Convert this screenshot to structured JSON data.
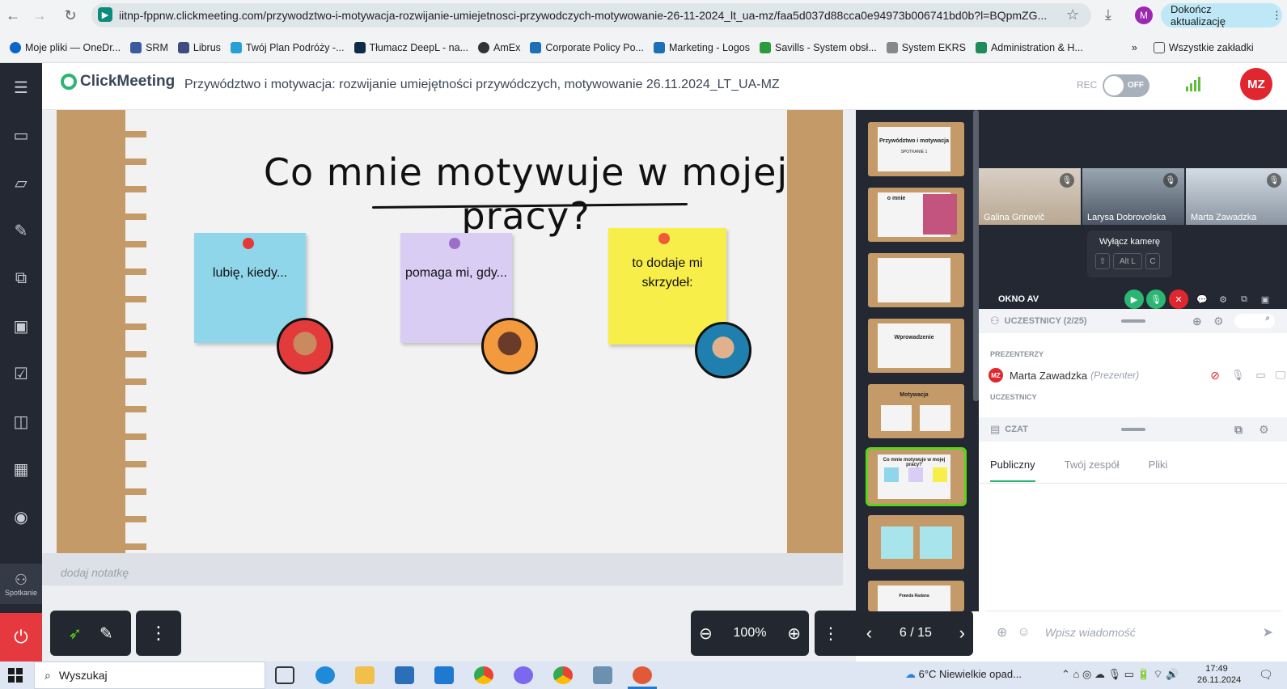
{
  "browser": {
    "url": "iitnp-fppnw.clickmeeting.com/przywodztwo-i-motywacja-rozwijanie-umiejetnosci-przywodczych-motywowanie-26-11-2024_lt_ua-mz/faa5d037d88cca0e94973b006741bd0b?l=BQpmZG...",
    "profile_initial": "M",
    "update_label": "Dokończ aktualizację",
    "bookmarks": [
      "Moje pliki — OneDr...",
      "SRM",
      "Librus",
      "Twój Plan Podróży -...",
      "Tłumacz DeepL - na...",
      "AmEx",
      "Corporate Policy Po...",
      "Marketing - Logos",
      "Savills - System obsł...",
      "System EKRS",
      "Administration & H..."
    ],
    "bookmarks_all": "Wszystkie zakładki"
  },
  "app": {
    "logo": "ClickMeeting",
    "meeting_title": "Przywództwo i motywacja: rozwijanie umiejętności przywódczych, motywowanie 26.11.2024_LT_UA-MZ",
    "rec_label": "REC",
    "rec_state": "OFF",
    "user_initials": "MZ",
    "accent_color": "#2bb673"
  },
  "leftnav": {
    "meeting_label": "Spotkanie"
  },
  "slide": {
    "title": "Co mnie motywuje w mojej pracy?",
    "notes": [
      {
        "text": "lubię, kiedy...",
        "color": "#8fd6ea"
      },
      {
        "text": "pomaga mi, gdy...",
        "color": "#d9cdf3"
      },
      {
        "text": "to dodaje mi skrzydeł:",
        "color": "#f7ee4a"
      }
    ]
  },
  "notes_placeholder": "dodaj notatkę",
  "toolbar": {
    "zoom": "100%",
    "page": "6 / 15"
  },
  "thumbnails": [
    {
      "label": "Przywództwo i motywacja",
      "sub": "SPOTKANIE 1"
    },
    {
      "label": "o mnie",
      "sub": ""
    },
    {
      "label": "",
      "sub": ""
    },
    {
      "label": "Wprowadzenie",
      "sub": ""
    },
    {
      "label": "Motywacja",
      "sub": ""
    },
    {
      "label": "Co mnie motywuje w mojej pracy?",
      "sub": ""
    },
    {
      "label": "",
      "sub": ""
    },
    {
      "label": "Prawda Radana",
      "sub": ""
    }
  ],
  "videos": [
    {
      "name": "Galina Grinevič"
    },
    {
      "name": "Larysa Dobrovolska"
    },
    {
      "name": "Marta Zawadzka"
    }
  ],
  "tooltip": {
    "title": "Wyłącz kamerę",
    "keys": [
      "Alt L",
      "C"
    ]
  },
  "av": {
    "label": "OKNO AV"
  },
  "participants": {
    "header": "UCZESTNICY (2/25)",
    "presenters_label": "PREZENTERZY",
    "presenter_initials": "MZ",
    "presenter_name": "Marta Zawadzka",
    "presenter_role": "(Prezenter)",
    "attendees_label": "UCZESTNICY"
  },
  "chat": {
    "header": "CZAT",
    "tabs": [
      "Publiczny",
      "Twój zespół",
      "Pliki"
    ],
    "placeholder": "Wpisz wiadomość"
  },
  "taskbar": {
    "search": "Wyszukaj",
    "weather": "6°C  Niewielkie opad...",
    "time": "17:49",
    "date": "26.11.2024"
  }
}
